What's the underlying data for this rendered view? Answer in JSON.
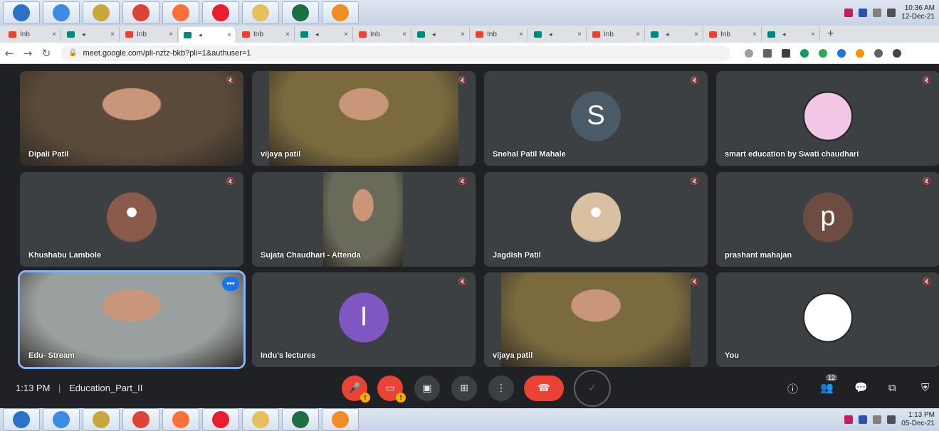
{
  "taskbar_top": {
    "apps": [
      {
        "icon": "windows-start-icon",
        "color": "#2b70c9"
      },
      {
        "icon": "internet-explorer-icon",
        "color": "#3c8ce7"
      },
      {
        "icon": "security-shield-icon",
        "color": "#c8a83b"
      },
      {
        "icon": "chrome-icon",
        "color": "#db4437"
      },
      {
        "icon": "firefox-icon",
        "color": "#ff7139"
      },
      {
        "icon": "opera-icon",
        "color": "#e8202e"
      },
      {
        "icon": "file-explorer-icon",
        "color": "#e5c15d"
      },
      {
        "icon": "excel-icon",
        "color": "#1d6f42"
      },
      {
        "icon": "g-app-icon",
        "color": "#f08d24"
      }
    ],
    "time": "10:36 AM",
    "date": "12-Dec-21"
  },
  "tabs": [
    {
      "label": "Inb",
      "type": "gmail"
    },
    {
      "label": "",
      "type": "meet"
    },
    {
      "label": "Inb",
      "type": "gmail"
    },
    {
      "label": "",
      "type": "meet",
      "active": true
    },
    {
      "label": "Inb",
      "type": "gmail"
    },
    {
      "label": "",
      "type": "meet"
    },
    {
      "label": "Inb",
      "type": "gmail"
    },
    {
      "label": "",
      "type": "meet"
    },
    {
      "label": "Inb",
      "type": "gmail"
    },
    {
      "label": "",
      "type": "meet"
    },
    {
      "label": "Inb",
      "type": "gmail"
    },
    {
      "label": "",
      "type": "meet"
    },
    {
      "label": "Inb",
      "type": "gmail"
    },
    {
      "label": "",
      "type": "meet"
    }
  ],
  "address": {
    "url": "meet.google.com/pli-nztz-bkb?pli=1&authuser=1"
  },
  "participants": [
    {
      "name": "Dipali Patil",
      "kind": "video",
      "bg": "#5a4a3a"
    },
    {
      "name": "vijaya patil",
      "kind": "video",
      "bg": "#7a6a3e"
    },
    {
      "name": "Snehal Patil Mahale",
      "kind": "initial",
      "initial": "S",
      "bg": "#4a5a66"
    },
    {
      "name": "smart education by Swati chaudhari",
      "kind": "logo",
      "bg": "#f4c6e6"
    },
    {
      "name": "Khushabu Lambole",
      "kind": "photo",
      "bg": "#8a5a4a"
    },
    {
      "name": "Sujata Chaudhari - Attenda",
      "kind": "video",
      "bg": "#6a6a5a"
    },
    {
      "name": "Jagdish Patil",
      "kind": "photo",
      "bg": "#d8c0a0"
    },
    {
      "name": "prashant mahajan",
      "kind": "initial",
      "initial": "p",
      "bg": "#6d4c41"
    },
    {
      "name": "Edu- Stream",
      "kind": "video",
      "bg": "#9aa0a0"
    },
    {
      "name": "Indu's lectures",
      "kind": "initial",
      "initial": "I",
      "bg": "#7e57c2"
    },
    {
      "name": "vijaya patil",
      "kind": "video",
      "bg": "#7a6a3e"
    },
    {
      "name": "You",
      "kind": "logo",
      "bg": "#ffffff"
    }
  ],
  "meeting": {
    "time": "1:13 PM",
    "separator": "|",
    "title": "Education_Part_II",
    "participant_count": "12"
  },
  "taskbar_bottom": {
    "time": "1:13 PM",
    "date": "05-Dec-21"
  },
  "colors": {
    "meet_bg": "#202124",
    "tile_bg": "#3c4043",
    "hangup": "#ea4335",
    "active_outline": "#8ab4f8"
  }
}
